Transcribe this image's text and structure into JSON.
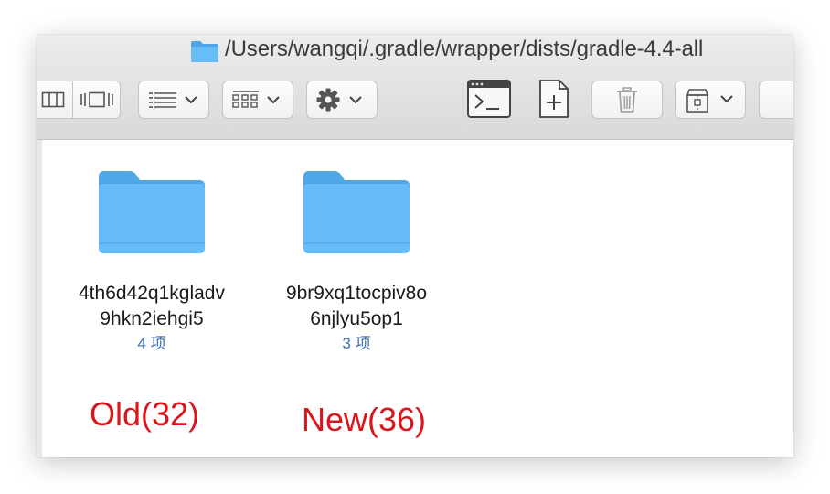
{
  "window": {
    "path_title": "/Users/wangqi/.gradle/wrapper/dists/gradle-4.4-all"
  },
  "toolbar": {
    "buttons": [
      {
        "name": "view-toggle",
        "icons": [
          "columns-view-icon",
          "coverflow-view-icon"
        ]
      },
      {
        "name": "arrange",
        "icon": "list-arrange-icon"
      },
      {
        "name": "group",
        "icon": "grid-group-icon"
      },
      {
        "name": "action",
        "icon": "gear-icon"
      },
      {
        "name": "terminal",
        "icon": "terminal-icon"
      },
      {
        "name": "new-file",
        "icon": "new-file-icon"
      },
      {
        "name": "delete",
        "icon": "trash-icon"
      },
      {
        "name": "share",
        "icon": "archive-icon"
      }
    ]
  },
  "items": [
    {
      "name_line1": "4th6d42q1kgladv",
      "name_line2": "9hkn2iehgi5",
      "count": "4 项",
      "annotation": "Old(32)"
    },
    {
      "name_line1": "9br9xq1tocpiv8o",
      "name_line2": "6njlyu5op1",
      "count": "3 项",
      "annotation": "New(36)"
    }
  ],
  "colors": {
    "folder": "#62b9f7",
    "annotation": "#d8161c",
    "count_text": "#3a6fb0"
  }
}
